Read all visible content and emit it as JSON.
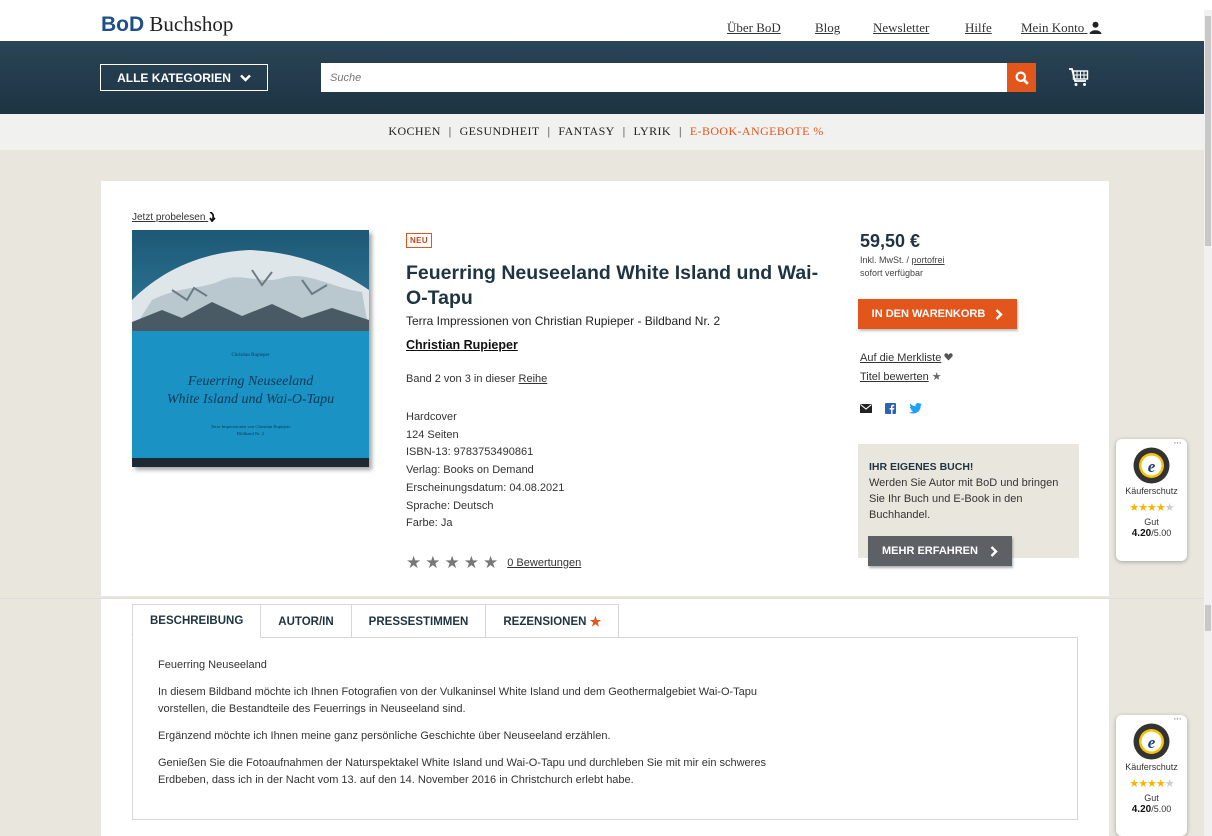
{
  "header": {
    "logo_brand": "BoD",
    "logo_text": " Buchshop",
    "links": [
      "Über BoD",
      "Blog",
      "Newsletter",
      "Hilfe",
      "Mein Konto"
    ]
  },
  "nav": {
    "categories_label": "ALLE KATEGORIEN",
    "search_placeholder": "Suche"
  },
  "category_bar": {
    "items": [
      "KOCHEN",
      "GESUNDHEIT",
      "FANTASY",
      "LYRIK"
    ],
    "promo": "E-BOOK-ANGEBOTE %"
  },
  "product": {
    "read_sample": "Jetzt probelesen",
    "badge": "NEU",
    "title": "Feuerring Neuseeland White Island und Wai-O-Tapu",
    "subtitle": "Terra Impressionen von Christian Rupieper - Bildband Nr. 2",
    "author": "Christian Rupieper",
    "series_text": "Band 2 von 3 in dieser ",
    "series_link": "Reihe",
    "details": [
      "Hardcover",
      "124 Seiten",
      "ISBN-13: 9783753490861",
      "Verlag: Books on Demand",
      "Erscheinungsdatum: 04.08.2021",
      "Sprache: Deutsch",
      "Farbe: Ja"
    ],
    "rating_stars": 5,
    "reviews_link": "0 Bewertungen",
    "cover": {
      "author": "Christian Rupieper",
      "title_line1": "Feuerring Neuseeland",
      "title_line2": "White Island und Wai-O-Tapu",
      "sub_line1": "Terra Impressionen von Christian Rupieper",
      "sub_line2": "Bildband Nr. 2"
    }
  },
  "buy": {
    "price": "59,50 €",
    "vat_text": "Inkl. MwSt. / ",
    "vat_link": "portofrei",
    "availability": "sofort verfügbar",
    "cart_button": "IN DEN WARENKORB",
    "wishlist": "Auf die Merkliste",
    "rate": "Titel bewerten"
  },
  "promo": {
    "heading": "IHR EIGENES BUCH!",
    "text": "Werden Sie Autor mit BoD und bringen Sie Ihr Buch und E-Book in den Buchhandel.",
    "button": "MEHR ERFAHREN"
  },
  "trusted": {
    "label": "Käuferschutz",
    "grade": "Gut",
    "score": "4.20",
    "max": "/5.00",
    "rating": 4.2
  },
  "tabs": {
    "items": [
      "BESCHREIBUNG",
      "AUTOR/IN",
      "PRESSESTIMMEN",
      "REZENSIONEN"
    ],
    "description": [
      "Feuerring Neuseeland",
      "In diesem Bildband möchte ich Ihnen Fotografien von der Vulkaninsel White Island und dem Geothermalgebiet Wai-O-Tapu vorstellen, die Bestandteile des Feuerrings in Neuseeland sind.",
      "Ergänzend möchte ich Ihnen meine ganz persönliche Geschichte über Neuseeland erzählen.",
      "Genießen Sie die Fotoaufnahmen der Naturspektakel White Island und Wai-O-Tapu und durchleben Sie mit mir ein schweres Erdbeben, dass ich in der Nacht vom 13. auf den 14. November 2016 in Christchurch erlebt habe."
    ]
  },
  "colors": {
    "accent": "#e2561c",
    "navy": "#1f3442",
    "cover_blue": "#1a92c4"
  }
}
